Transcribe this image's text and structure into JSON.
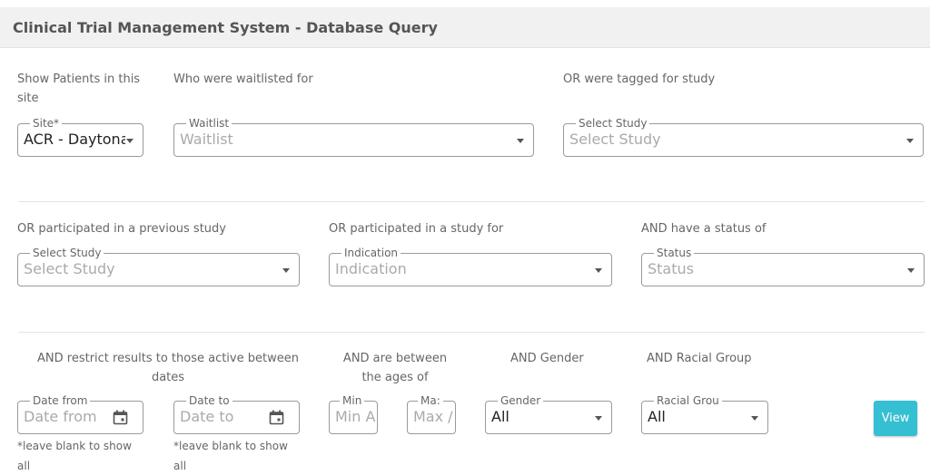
{
  "header": {
    "title": "Clinical Trial Management System - Database Query"
  },
  "row1": {
    "site_label": "Show Patients in this site",
    "site": {
      "legend": "Site*",
      "value": "ACR - Daytona"
    },
    "waitlist_label": "Who were waitlisted for",
    "waitlist": {
      "legend": "Waitlist",
      "placeholder": "Waitlist"
    },
    "tagged_label": "OR were tagged for study",
    "tagged_study": {
      "legend": "Select Study",
      "placeholder": "Select Study"
    }
  },
  "row2": {
    "prev_label": "OR participated in a previous study",
    "prev_study": {
      "legend": "Select Study",
      "placeholder": "Select Study"
    },
    "indication_label": "OR participated in a study for",
    "indication": {
      "legend": "Indication",
      "placeholder": "Indication"
    },
    "status_label": "AND have a status of",
    "status": {
      "legend": "Status",
      "placeholder": "Status"
    }
  },
  "row3": {
    "dates_label": "AND restrict results to those active between dates",
    "date_from": {
      "legend": "Date from",
      "placeholder": "Date from",
      "hint": "*leave blank to show all"
    },
    "date_to": {
      "legend": "Date to",
      "placeholder": "Date to",
      "hint": "*leave blank to show all"
    },
    "ages_label": "AND are between the ages of",
    "min_age": {
      "legend": "Min",
      "placeholder": "Min A"
    },
    "max_age": {
      "legend": "Ma:",
      "placeholder": "Max /"
    },
    "gender_label": "AND Gender",
    "gender": {
      "legend": "Gender",
      "value": "All"
    },
    "race_label": "AND Racial Group",
    "race": {
      "legend": "Racial Grou",
      "value": "All"
    },
    "view_button": "View"
  },
  "colors": {
    "accent": "#35bfd2",
    "header_bg": "#f1f1f1",
    "border": "#9a9a9a"
  }
}
